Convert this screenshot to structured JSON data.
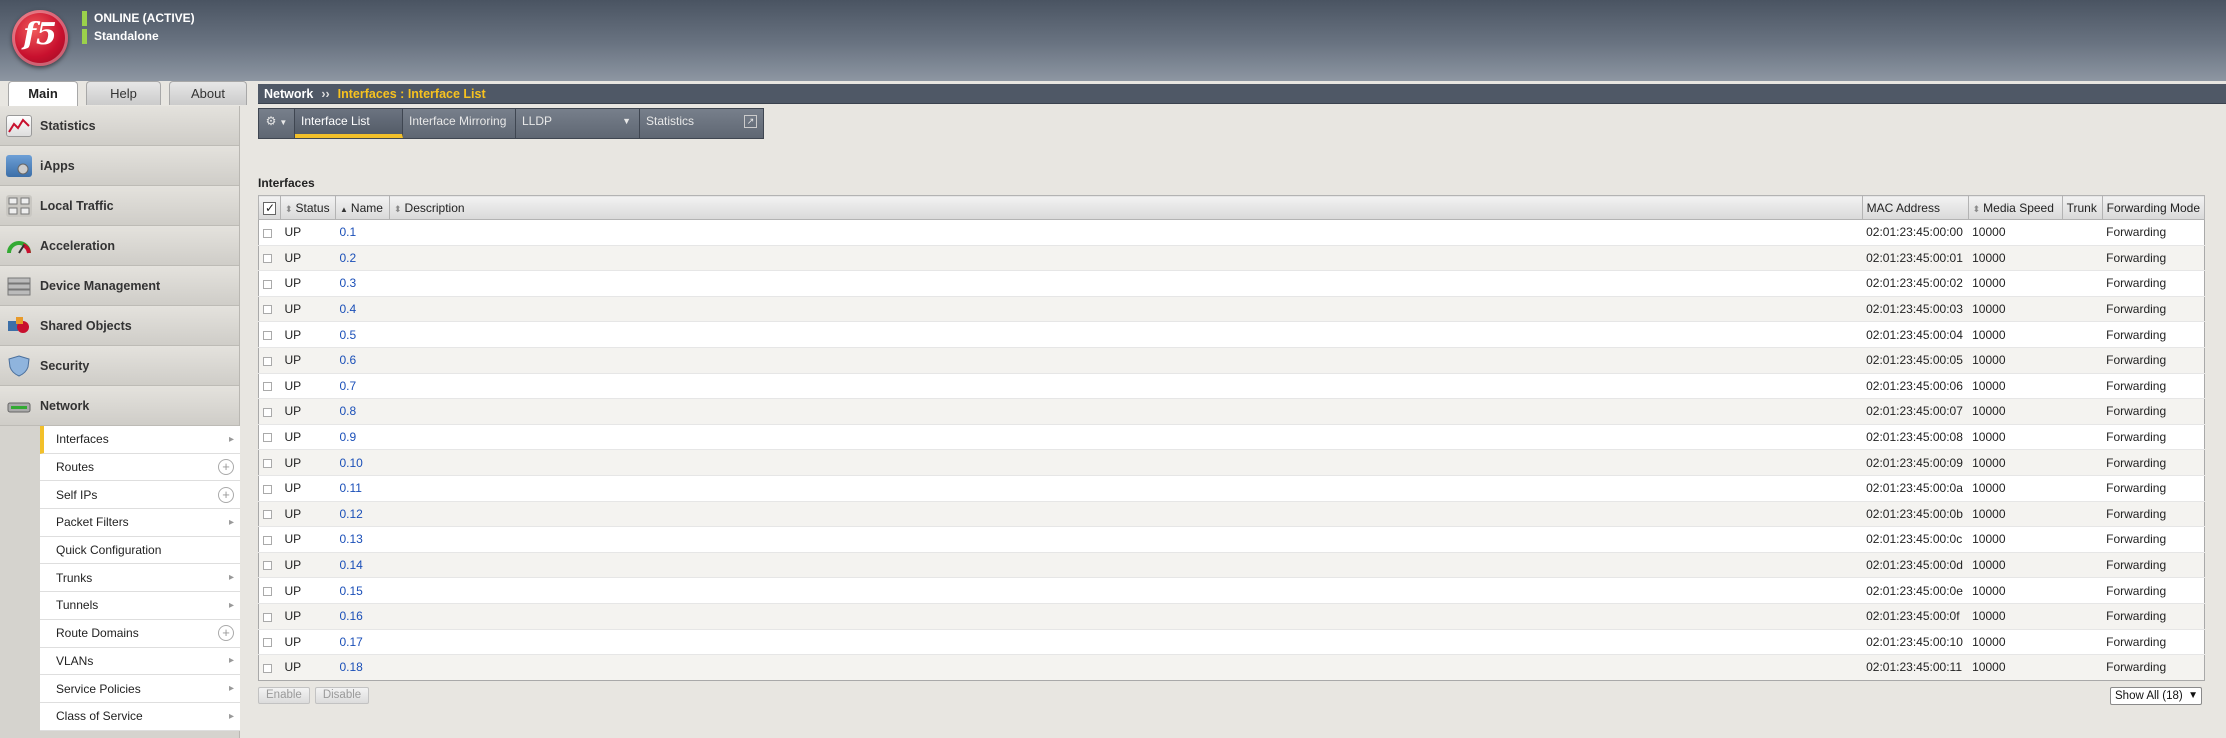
{
  "system": {
    "status": "ONLINE (ACTIVE)",
    "mode": "Standalone",
    "logo_text": "f5"
  },
  "top_tabs": [
    {
      "label": "Main"
    },
    {
      "label": "Help"
    },
    {
      "label": "About"
    }
  ],
  "sidebar": {
    "sections": [
      {
        "label": "Statistics",
        "icon": "statistics-icon"
      },
      {
        "label": "iApps",
        "icon": "iapps-icon"
      },
      {
        "label": "Local Traffic",
        "icon": "local-traffic-icon"
      },
      {
        "label": "Acceleration",
        "icon": "acceleration-icon"
      },
      {
        "label": "Device Management",
        "icon": "device-management-icon"
      },
      {
        "label": "Shared Objects",
        "icon": "shared-objects-icon"
      },
      {
        "label": "Security",
        "icon": "security-icon"
      },
      {
        "label": "Network",
        "icon": "network-icon"
      }
    ],
    "network_items": [
      {
        "label": "Interfaces",
        "trail": "arrow"
      },
      {
        "label": "Routes",
        "trail": "plus"
      },
      {
        "label": "Self IPs",
        "trail": "plus"
      },
      {
        "label": "Packet Filters",
        "trail": "arrow"
      },
      {
        "label": "Quick Configuration",
        "trail": ""
      },
      {
        "label": "Trunks",
        "trail": "arrow"
      },
      {
        "label": "Tunnels",
        "trail": "arrow"
      },
      {
        "label": "Route Domains",
        "trail": "plus"
      },
      {
        "label": "VLANs",
        "trail": "arrow"
      },
      {
        "label": "Service Policies",
        "trail": "arrow"
      },
      {
        "label": "Class of Service",
        "trail": "arrow"
      }
    ]
  },
  "breadcrumb": {
    "root": "Network",
    "separator": "››",
    "current": "Interfaces : Interface List"
  },
  "toolbar": {
    "tabs": [
      {
        "label": "Interface List"
      },
      {
        "label": "Interface Mirroring"
      },
      {
        "label": "LLDP"
      },
      {
        "label": "Statistics"
      }
    ]
  },
  "table": {
    "title": "Interfaces",
    "columns": [
      "Status",
      "Name",
      "Description",
      "MAC Address",
      "Media Speed",
      "Trunk",
      "Forwarding Mode"
    ],
    "rows": [
      {
        "status": "UP",
        "name": "0.1",
        "description": "",
        "mac": "02:01:23:45:00:00",
        "speed": "10000",
        "trunk": "",
        "mode": "Forwarding"
      },
      {
        "status": "UP",
        "name": "0.2",
        "description": "",
        "mac": "02:01:23:45:00:01",
        "speed": "10000",
        "trunk": "",
        "mode": "Forwarding"
      },
      {
        "status": "UP",
        "name": "0.3",
        "description": "",
        "mac": "02:01:23:45:00:02",
        "speed": "10000",
        "trunk": "",
        "mode": "Forwarding"
      },
      {
        "status": "UP",
        "name": "0.4",
        "description": "",
        "mac": "02:01:23:45:00:03",
        "speed": "10000",
        "trunk": "",
        "mode": "Forwarding"
      },
      {
        "status": "UP",
        "name": "0.5",
        "description": "",
        "mac": "02:01:23:45:00:04",
        "speed": "10000",
        "trunk": "",
        "mode": "Forwarding"
      },
      {
        "status": "UP",
        "name": "0.6",
        "description": "",
        "mac": "02:01:23:45:00:05",
        "speed": "10000",
        "trunk": "",
        "mode": "Forwarding"
      },
      {
        "status": "UP",
        "name": "0.7",
        "description": "",
        "mac": "02:01:23:45:00:06",
        "speed": "10000",
        "trunk": "",
        "mode": "Forwarding"
      },
      {
        "status": "UP",
        "name": "0.8",
        "description": "",
        "mac": "02:01:23:45:00:07",
        "speed": "10000",
        "trunk": "",
        "mode": "Forwarding"
      },
      {
        "status": "UP",
        "name": "0.9",
        "description": "",
        "mac": "02:01:23:45:00:08",
        "speed": "10000",
        "trunk": "",
        "mode": "Forwarding"
      },
      {
        "status": "UP",
        "name": "0.10",
        "description": "",
        "mac": "02:01:23:45:00:09",
        "speed": "10000",
        "trunk": "",
        "mode": "Forwarding"
      },
      {
        "status": "UP",
        "name": "0.11",
        "description": "",
        "mac": "02:01:23:45:00:0a",
        "speed": "10000",
        "trunk": "",
        "mode": "Forwarding"
      },
      {
        "status": "UP",
        "name": "0.12",
        "description": "",
        "mac": "02:01:23:45:00:0b",
        "speed": "10000",
        "trunk": "",
        "mode": "Forwarding"
      },
      {
        "status": "UP",
        "name": "0.13",
        "description": "",
        "mac": "02:01:23:45:00:0c",
        "speed": "10000",
        "trunk": "",
        "mode": "Forwarding"
      },
      {
        "status": "UP",
        "name": "0.14",
        "description": "",
        "mac": "02:01:23:45:00:0d",
        "speed": "10000",
        "trunk": "",
        "mode": "Forwarding"
      },
      {
        "status": "UP",
        "name": "0.15",
        "description": "",
        "mac": "02:01:23:45:00:0e",
        "speed": "10000",
        "trunk": "",
        "mode": "Forwarding"
      },
      {
        "status": "UP",
        "name": "0.16",
        "description": "",
        "mac": "02:01:23:45:00:0f",
        "speed": "10000",
        "trunk": "",
        "mode": "Forwarding"
      },
      {
        "status": "UP",
        "name": "0.17",
        "description": "",
        "mac": "02:01:23:45:00:10",
        "speed": "10000",
        "trunk": "",
        "mode": "Forwarding"
      },
      {
        "status": "UP",
        "name": "0.18",
        "description": "",
        "mac": "02:01:23:45:00:11",
        "speed": "10000",
        "trunk": "",
        "mode": "Forwarding"
      }
    ]
  },
  "footer": {
    "enable_label": "Enable",
    "disable_label": "Disable",
    "show_all": "Show All (18)"
  },
  "colors": {
    "accent": "#f2c02a",
    "status_ok": "#9bd14b",
    "link": "#1a4fb8",
    "brand": "#c8102e"
  }
}
